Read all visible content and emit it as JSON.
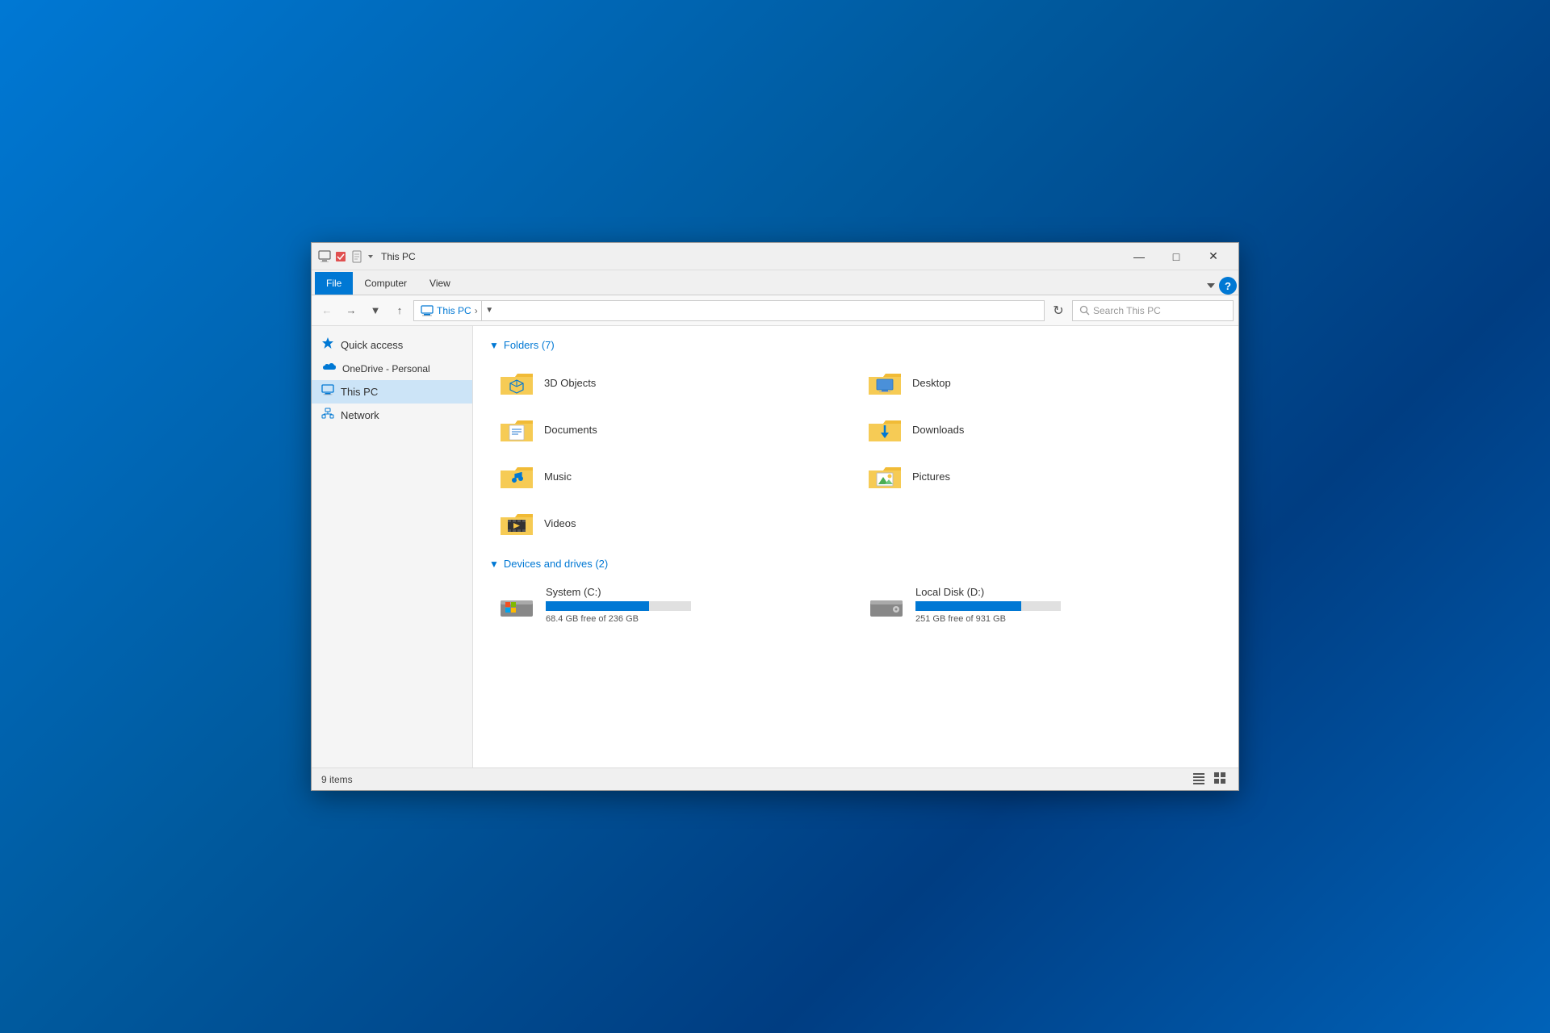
{
  "window": {
    "title": "This PC",
    "titlebar_icons": [
      "monitor-icon",
      "check-icon",
      "page-icon"
    ]
  },
  "ribbon": {
    "tabs": [
      {
        "id": "file",
        "label": "File",
        "active": true
      },
      {
        "id": "computer",
        "label": "Computer",
        "active": false
      },
      {
        "id": "view",
        "label": "View",
        "active": false
      }
    ]
  },
  "address_bar": {
    "path_icon": "computer-icon",
    "path_root": "This PC",
    "path_separator": ">",
    "placeholder": "Search This PC",
    "chevron": "▾",
    "refresh": "↻"
  },
  "sidebar": {
    "items": [
      {
        "id": "quick-access",
        "label": "Quick access",
        "icon": "⭐"
      },
      {
        "id": "onedrive",
        "label": "OneDrive - Personal",
        "icon": "☁"
      },
      {
        "id": "this-pc",
        "label": "This PC",
        "icon": "🖥",
        "active": true
      },
      {
        "id": "network",
        "label": "Network",
        "icon": "🔗"
      }
    ]
  },
  "folders_section": {
    "title": "Folders (7)",
    "folders": [
      {
        "id": "3d-objects",
        "name": "3D Objects"
      },
      {
        "id": "desktop",
        "name": "Desktop"
      },
      {
        "id": "documents",
        "name": "Documents"
      },
      {
        "id": "downloads",
        "name": "Downloads"
      },
      {
        "id": "music",
        "name": "Music"
      },
      {
        "id": "pictures",
        "name": "Pictures"
      },
      {
        "id": "videos",
        "name": "Videos"
      }
    ]
  },
  "drives_section": {
    "title": "Devices and drives (2)",
    "drives": [
      {
        "id": "c-drive",
        "name": "System (C:)",
        "free_gb": 68.4,
        "total_gb": 236,
        "free_text": "68.4 GB free of 236 GB",
        "used_pct": 71
      },
      {
        "id": "d-drive",
        "name": "Local Disk (D:)",
        "free_gb": 251,
        "total_gb": 931,
        "free_text": "251 GB free of 931 GB",
        "used_pct": 73
      }
    ]
  },
  "status_bar": {
    "item_count": "9 items"
  }
}
